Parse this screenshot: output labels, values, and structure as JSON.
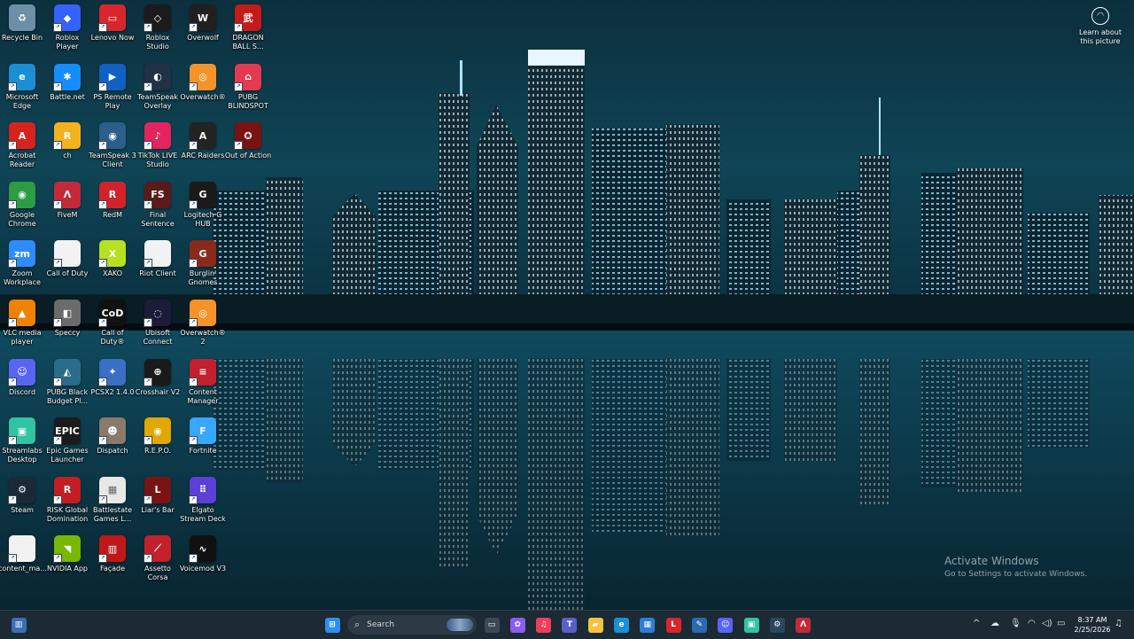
{
  "desktop_icons": [
    {
      "label": "Recycle Bin",
      "icon": "recycle-bin-icon",
      "color": "#6d8fa8",
      "glyph": "♻",
      "col": 0,
      "row": 0
    },
    {
      "label": "Roblox Player",
      "icon": "roblox-player-icon",
      "color": "#3562ff",
      "glyph": "◆",
      "col": 1,
      "row": 0
    },
    {
      "label": "Lenovo Now",
      "icon": "lenovo-now-icon",
      "color": "#d9262c",
      "glyph": "▭",
      "col": 2,
      "row": 0
    },
    {
      "label": "Roblox Studio",
      "icon": "roblox-studio-icon",
      "color": "#1b1b1b",
      "glyph": "◇",
      "col": 3,
      "row": 0
    },
    {
      "label": "Overwolf",
      "icon": "overwolf-icon",
      "color": "#202020",
      "glyph": "W",
      "col": 4,
      "row": 0
    },
    {
      "label": "DRAGON BALL S...",
      "icon": "dragon-ball-icon",
      "color": "#c41a1a",
      "glyph": "武",
      "col": 5,
      "row": 0
    },
    {
      "label": "Microsoft Edge",
      "icon": "microsoft-edge-icon",
      "color": "#1a8fd6",
      "glyph": "e",
      "col": 0,
      "row": 1
    },
    {
      "label": "Battle.net",
      "icon": "battle-net-icon",
      "color": "#148eff",
      "glyph": "✱",
      "col": 1,
      "row": 1
    },
    {
      "label": "PS Remote Play",
      "icon": "ps-remote-play-icon",
      "color": "#0f62c4",
      "glyph": "▶",
      "col": 2,
      "row": 1
    },
    {
      "label": "TeamSpeak Overlay",
      "icon": "teamspeak-overlay-icon",
      "color": "#213146",
      "glyph": "◐",
      "col": 3,
      "row": 1
    },
    {
      "label": "Overwatch®",
      "icon": "overwatch-icon",
      "color": "#f4932a",
      "glyph": "◎",
      "col": 4,
      "row": 1
    },
    {
      "label": "PUBG BLINDSPOT",
      "icon": "pubg-blindspot-icon",
      "color": "#e5394f",
      "glyph": "⌂",
      "col": 5,
      "row": 1
    },
    {
      "label": "Acrobat Reader",
      "icon": "acrobat-reader-icon",
      "color": "#d6231e",
      "glyph": "A",
      "col": 0,
      "row": 2
    },
    {
      "label": "ch",
      "icon": "rockstar-icon",
      "color": "#f3b21c",
      "glyph": "R",
      "col": 1,
      "row": 2
    },
    {
      "label": "TeamSpeak 3 Client",
      "icon": "teamspeak-client-icon",
      "color": "#2b5e8a",
      "glyph": "◉",
      "col": 2,
      "row": 2
    },
    {
      "label": "TikTok LIVE Studio",
      "icon": "tiktok-live-icon",
      "color": "#e3245e",
      "glyph": "♪",
      "col": 3,
      "row": 2
    },
    {
      "label": "ARC Raiders",
      "icon": "arc-raiders-icon",
      "color": "#232323",
      "glyph": "A",
      "col": 4,
      "row": 2
    },
    {
      "label": "Out of Action",
      "icon": "out-of-action-icon",
      "color": "#7a1212",
      "glyph": "✪",
      "col": 5,
      "row": 2
    },
    {
      "label": "Google Chrome",
      "icon": "google-chrome-icon",
      "color": "#2c9c45",
      "glyph": "◉",
      "col": 0,
      "row": 3
    },
    {
      "label": "FiveM",
      "icon": "fivem-icon",
      "color": "#c22a3a",
      "glyph": "Λ",
      "col": 1,
      "row": 3
    },
    {
      "label": "RedM",
      "icon": "redm-icon",
      "color": "#d2232a",
      "glyph": "R",
      "col": 2,
      "row": 3
    },
    {
      "label": "Final Sentence",
      "icon": "final-sentence-icon",
      "color": "#5a1a1a",
      "glyph": "FS",
      "col": 3,
      "row": 3
    },
    {
      "label": "Logitech G HUB",
      "icon": "logitech-g-hub-icon",
      "color": "#1a1a1a",
      "glyph": "G",
      "col": 4,
      "row": 3
    },
    {
      "label": "Zoom Workplace",
      "icon": "zoom-icon",
      "color": "#2d8cff",
      "glyph": "zm",
      "col": 0,
      "row": 4
    },
    {
      "label": "Call of Duty",
      "icon": "call-of-duty-file-icon",
      "color": "#f2f2f2",
      "glyph": "",
      "col": 1,
      "row": 4
    },
    {
      "label": "XAKO",
      "icon": "xako-icon",
      "color": "#b6e022",
      "glyph": "X",
      "col": 2,
      "row": 4
    },
    {
      "label": "Riot Client",
      "icon": "riot-client-file-icon",
      "color": "#f2f2f2",
      "glyph": "",
      "col": 3,
      "row": 4
    },
    {
      "label": "Burglin' Gnomes",
      "icon": "burglin-gnomes-icon",
      "color": "#8a2a1a",
      "glyph": "G",
      "col": 4,
      "row": 4
    },
    {
      "label": "VLC media player",
      "icon": "vlc-icon",
      "color": "#ef8200",
      "glyph": "▲",
      "col": 0,
      "row": 5
    },
    {
      "label": "Speccy",
      "icon": "speccy-icon",
      "color": "#6b6b6b",
      "glyph": "◧",
      "col": 1,
      "row": 5
    },
    {
      "label": "Call of Duty®",
      "icon": "call-of-duty-icon",
      "color": "#111111",
      "glyph": "CoD",
      "col": 2,
      "row": 5
    },
    {
      "label": "Ubisoft Connect",
      "icon": "ubisoft-connect-icon",
      "color": "#1c1c3a",
      "glyph": "◌",
      "col": 3,
      "row": 5
    },
    {
      "label": "Overwatch® 2",
      "icon": "overwatch-2-icon",
      "color": "#f4932a",
      "glyph": "◎",
      "col": 4,
      "row": 5
    },
    {
      "label": "Discord",
      "icon": "discord-icon",
      "color": "#5865f2",
      "glyph": "☺",
      "col": 0,
      "row": 6
    },
    {
      "label": "PUBG Black Budget Pl...",
      "icon": "pubg-black-budget-icon",
      "color": "#2a6c8a",
      "glyph": "◭",
      "col": 1,
      "row": 6
    },
    {
      "label": "PCSX2 1.4.0",
      "icon": "pcsx2-icon",
      "color": "#3b6fc4",
      "glyph": "✦",
      "col": 2,
      "row": 6
    },
    {
      "label": "Crosshair V2",
      "icon": "crosshair-v2-icon",
      "color": "#1a1a1a",
      "glyph": "⊕",
      "col": 3,
      "row": 6
    },
    {
      "label": "Content Manager",
      "icon": "content-manager-icon",
      "color": "#c21f2f",
      "glyph": "≡",
      "col": 4,
      "row": 6
    },
    {
      "label": "Streamlabs Desktop",
      "icon": "streamlabs-icon",
      "color": "#31c3a2",
      "glyph": "▣",
      "col": 0,
      "row": 7
    },
    {
      "label": "Epic Games Launcher",
      "icon": "epic-games-icon",
      "color": "#1b1b1b",
      "glyph": "EPIC",
      "col": 1,
      "row": 7
    },
    {
      "label": "Dispatch",
      "icon": "dispatch-icon",
      "color": "#8a7a6a",
      "glyph": "☻",
      "col": 2,
      "row": 7
    },
    {
      "label": "R.E.P.O.",
      "icon": "repo-icon",
      "color": "#e0a800",
      "glyph": "◉",
      "col": 3,
      "row": 7
    },
    {
      "label": "Fortnite",
      "icon": "fortnite-icon",
      "color": "#38a8ff",
      "glyph": "F",
      "col": 4,
      "row": 7
    },
    {
      "label": "Steam",
      "icon": "steam-icon",
      "color": "#1b2838",
      "glyph": "⚙",
      "col": 0,
      "row": 8
    },
    {
      "label": "RISK Global Domination",
      "icon": "risk-icon",
      "color": "#c21e24",
      "glyph": "R",
      "col": 1,
      "row": 8
    },
    {
      "label": "Battlestate Games L...",
      "icon": "battlestate-icon",
      "color": "#e8e8e8",
      "glyph": "▦",
      "col": 2,
      "row": 8
    },
    {
      "label": "Liar's Bar",
      "icon": "liars-bar-icon",
      "color": "#7a1414",
      "glyph": "L",
      "col": 3,
      "row": 8
    },
    {
      "label": "Elgato Stream Deck",
      "icon": "elgato-stream-deck-icon",
      "color": "#5b3fd6",
      "glyph": "⠿",
      "col": 4,
      "row": 8
    },
    {
      "label": "content_ma...",
      "icon": "text-file-icon",
      "color": "#f2f2f2",
      "glyph": "",
      "col": 0,
      "row": 9
    },
    {
      "label": "NVIDIA App",
      "icon": "nvidia-icon",
      "color": "#76b900",
      "glyph": "◥",
      "col": 1,
      "row": 9
    },
    {
      "label": "Façade",
      "icon": "facade-icon",
      "color": "#c01818",
      "glyph": "▥",
      "col": 2,
      "row": 9
    },
    {
      "label": "Assetto Corsa",
      "icon": "assetto-corsa-icon",
      "color": "#c2202a",
      "glyph": "⟋",
      "col": 3,
      "row": 9
    },
    {
      "label": "Voicemod V3",
      "icon": "voicemod-icon",
      "color": "#111111",
      "glyph": "∿",
      "col": 4,
      "row": 9
    }
  ],
  "spotlight": {
    "label": "Learn about this picture",
    "icon": "camera-lens-icon"
  },
  "watermark": {
    "title": "Activate Windows",
    "subtitle": "Go to Settings to activate Windows."
  },
  "taskbar": {
    "widgets_icon": "widgets-icon",
    "search_placeholder": "Search",
    "pinned": [
      {
        "name": "start-button",
        "glyph": "⊞",
        "color": "#2f8ef0"
      },
      {
        "name": "task-view-button",
        "glyph": "▭",
        "color": "#3a4a55"
      },
      {
        "name": "copilot-button",
        "glyph": "✿",
        "color": "#8a5cf0"
      },
      {
        "name": "music-app-button",
        "glyph": "♫",
        "color": "#f23c5a"
      },
      {
        "name": "teams-button",
        "glyph": "T",
        "color": "#5b5fc7"
      },
      {
        "name": "file-explorer-button",
        "glyph": "▰",
        "color": "#f5c242"
      },
      {
        "name": "edge-button",
        "glyph": "e",
        "color": "#1a8fd6"
      },
      {
        "name": "store-button",
        "glyph": "▦",
        "color": "#2b7fd6"
      },
      {
        "name": "lenovo-button",
        "glyph": "L",
        "color": "#d9262c"
      },
      {
        "name": "app-button",
        "glyph": "✎",
        "color": "#2a6ab0"
      },
      {
        "name": "discord-button",
        "glyph": "☺",
        "color": "#5865f2"
      },
      {
        "name": "streamlabs-button",
        "glyph": "▣",
        "color": "#31c3a2"
      },
      {
        "name": "steam-button",
        "glyph": "⚙",
        "color": "#2a475e"
      },
      {
        "name": "fivem-button",
        "glyph": "Λ",
        "color": "#c22a3a"
      }
    ],
    "tray": {
      "chevron": "^",
      "time": "8:37 AM",
      "date": "2/25/2026"
    }
  }
}
